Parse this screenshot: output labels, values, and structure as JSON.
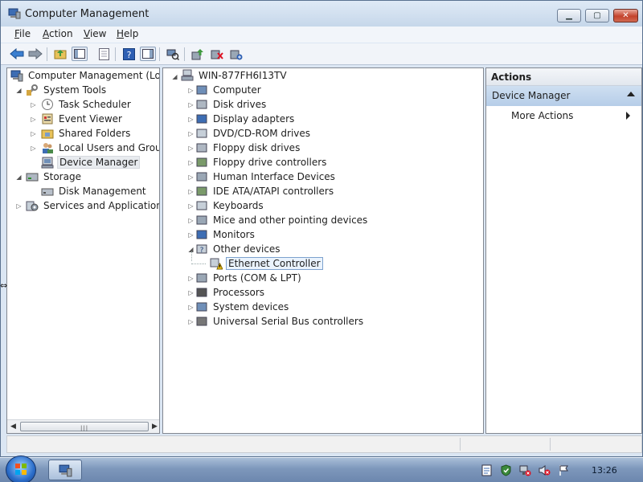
{
  "window": {
    "title": "Computer Management",
    "colors": {
      "titlebar": "#cfdcec",
      "selection_border": "#7da2ce",
      "actions_bar": "#b6cde8"
    }
  },
  "menu": {
    "file": {
      "mnemonic": "F",
      "rest": "ile"
    },
    "action": {
      "mnemonic": "A",
      "rest": "ction"
    },
    "view": {
      "mnemonic": "V",
      "rest": "iew"
    },
    "help": {
      "mnemonic": "H",
      "rest": "elp"
    }
  },
  "toolbar_icons": [
    "back-arrow-icon",
    "forward-arrow-icon",
    "up-folder-icon",
    "show-hide-tree-icon",
    "properties-icon",
    "help-icon",
    "show-hide-action-pane-icon",
    "scan-hardware-icon",
    "update-driver-icon",
    "uninstall-icon",
    "enable-device-icon"
  ],
  "left_tree": {
    "root": "Computer Management (Local",
    "system_tools": "System Tools",
    "task_scheduler": "Task Scheduler",
    "event_viewer": "Event Viewer",
    "shared_folders": "Shared Folders",
    "local_users": "Local Users and Groups",
    "device_manager": "Device Manager",
    "storage": "Storage",
    "disk_management": "Disk Management",
    "services": "Services and Applications"
  },
  "device_tree": {
    "computer_name": "WIN-877FH6I13TV",
    "categories": [
      "Computer",
      "Disk drives",
      "Display adapters",
      "DVD/CD-ROM drives",
      "Floppy disk drives",
      "Floppy drive controllers",
      "Human Interface Devices",
      "IDE ATA/ATAPI controllers",
      "Keyboards",
      "Mice and other pointing devices",
      "Monitors",
      "Other devices",
      "Ports (COM & LPT)",
      "Processors",
      "System devices",
      "Universal Serial Bus controllers"
    ],
    "other_devices_child": "Ethernet Controller"
  },
  "actions": {
    "header": "Actions",
    "section": "Device Manager",
    "more": "More Actions"
  },
  "taskbar": {
    "clock": "13:26"
  }
}
